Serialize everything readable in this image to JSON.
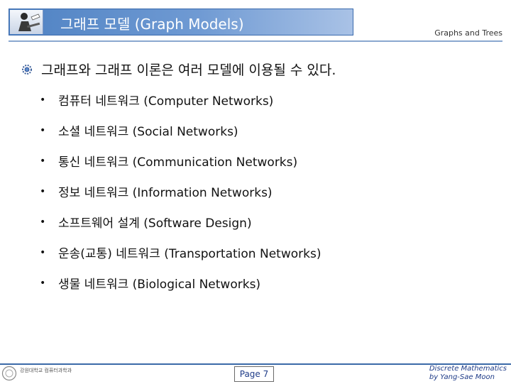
{
  "header": {
    "title": "그래프 모델 (Graph Models)",
    "right_label": "Graphs and Trees"
  },
  "main_point": "그래프와 그래프 이론은 여러 모델에 이용될 수 있다.",
  "sub_bullet_symbol": "•",
  "items": [
    "컴퓨터 네트워크 (Computer Networks)",
    "소셜 네트워크 (Social Networks)",
    "통신 네트워크 (Communication Networks)",
    "정보 네트워크 (Information Networks)",
    "소프트웨어 설계 (Software Design)",
    "운송(교통) 네트워크 (Transportation Networks)",
    "생물 네트워크 (Biological Networks)"
  ],
  "footer": {
    "logo_text": "강원대학교 컴퓨터과학과",
    "page": "Page 7",
    "course_line1": "Discrete Mathematics",
    "course_line2": "by Yang-Sae Moon"
  },
  "colors": {
    "title_bar": "#5b8bc9",
    "accent_blue": "#1f3c88",
    "rule": "#3b6aa8"
  }
}
